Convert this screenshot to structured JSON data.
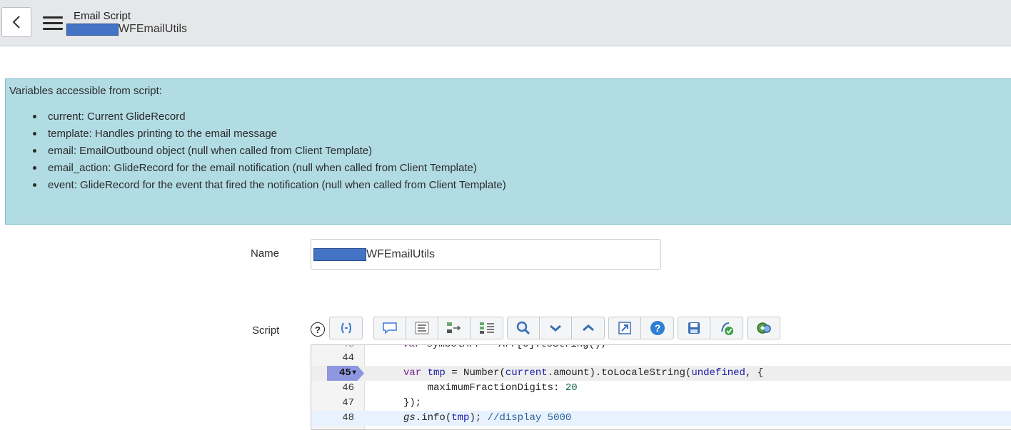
{
  "header": {
    "title": "Email Script",
    "subtitle_suffix": "WFEmailUtils"
  },
  "info": {
    "title": "Variables accessible from script:",
    "items": [
      "current: Current GlideRecord",
      "template: Handles printing to the email message",
      "email: EmailOutbound object (null when called from Client Template)",
      "email_action: GlideRecord for the email notification (null when called from Client Template)",
      "event: GlideRecord for the event that fired the notification (null when called from Client Template)"
    ]
  },
  "form": {
    "name_label": "Name",
    "name_value_suffix": "WFEmailUtils",
    "script_label": "Script",
    "help_glyph": "?"
  },
  "toolbar": {
    "icons": [
      "format-code-icon",
      "comment-icon",
      "toggle-comment-icon",
      "replace-icon",
      "replace-all-icon",
      "search-icon",
      "next-icon",
      "previous-icon",
      "fullscreen-icon",
      "help-icon",
      "save-icon",
      "check-syntax-icon",
      "debug-icon"
    ]
  },
  "editor": {
    "lines": [
      {
        "num": "44",
        "code": ""
      },
      {
        "num": "45",
        "code": "var tmp = Number(current.amount).toLocaleString(undefined, {"
      },
      {
        "num": "46",
        "code": "    maximumFractionDigits: 20"
      },
      {
        "num": "47",
        "code": "});"
      },
      {
        "num": "48",
        "code": "gs.info(tmp); //display 5000"
      }
    ]
  }
}
